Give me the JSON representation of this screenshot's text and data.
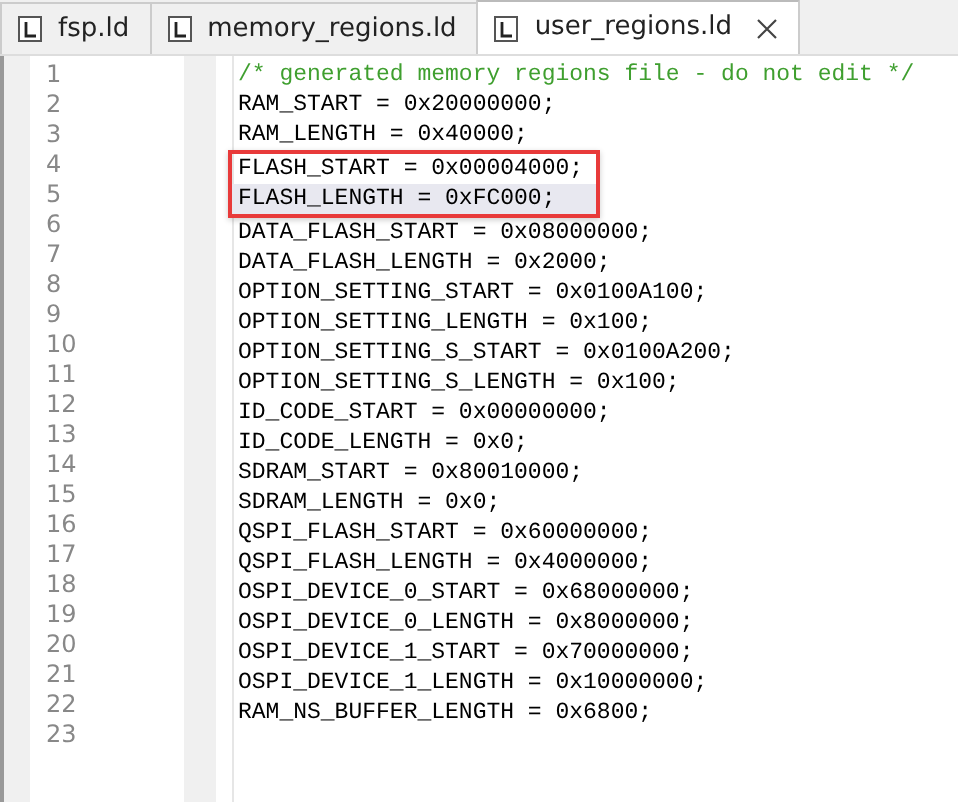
{
  "tabs": [
    {
      "label": "fsp.ld",
      "selected": false
    },
    {
      "label": "memory_regions.ld",
      "selected": false
    },
    {
      "label": "user_regions.ld",
      "selected": true
    }
  ],
  "editor": {
    "lines": [
      {
        "number": "1",
        "text": "/* generated memory regions file - do not edit */",
        "kind": "comment",
        "current": false,
        "highlighted": false
      },
      {
        "number": "2",
        "text": "RAM_START = 0x20000000;",
        "kind": "code",
        "current": false,
        "highlighted": false
      },
      {
        "number": "3",
        "text": "RAM_LENGTH = 0x40000;",
        "kind": "code",
        "current": false,
        "highlighted": false
      },
      {
        "number": "4",
        "text": "FLASH_START = 0x00004000;",
        "kind": "code",
        "current": false,
        "highlighted": true
      },
      {
        "number": "5",
        "text": "FLASH_LENGTH = 0xFC000;",
        "kind": "code",
        "current": true,
        "highlighted": true
      },
      {
        "number": "6",
        "text": "DATA_FLASH_START = 0x08000000;",
        "kind": "code",
        "current": false,
        "highlighted": false
      },
      {
        "number": "7",
        "text": "DATA_FLASH_LENGTH = 0x2000;",
        "kind": "code",
        "current": false,
        "highlighted": false
      },
      {
        "number": "8",
        "text": "OPTION_SETTING_START = 0x0100A100;",
        "kind": "code",
        "current": false,
        "highlighted": false
      },
      {
        "number": "9",
        "text": "OPTION_SETTING_LENGTH = 0x100;",
        "kind": "code",
        "current": false,
        "highlighted": false
      },
      {
        "number": "10",
        "text": "OPTION_SETTING_S_START = 0x0100A200;",
        "kind": "code",
        "current": false,
        "highlighted": false
      },
      {
        "number": "11",
        "text": "OPTION_SETTING_S_LENGTH = 0x100;",
        "kind": "code",
        "current": false,
        "highlighted": false
      },
      {
        "number": "12",
        "text": "ID_CODE_START = 0x00000000;",
        "kind": "code",
        "current": false,
        "highlighted": false
      },
      {
        "number": "13",
        "text": "ID_CODE_LENGTH = 0x0;",
        "kind": "code",
        "current": false,
        "highlighted": false
      },
      {
        "number": "14",
        "text": "SDRAM_START = 0x80010000;",
        "kind": "code",
        "current": false,
        "highlighted": false
      },
      {
        "number": "15",
        "text": "SDRAM_LENGTH = 0x0;",
        "kind": "code",
        "current": false,
        "highlighted": false
      },
      {
        "number": "16",
        "text": "QSPI_FLASH_START = 0x60000000;",
        "kind": "code",
        "current": false,
        "highlighted": false
      },
      {
        "number": "17",
        "text": "QSPI_FLASH_LENGTH = 0x4000000;",
        "kind": "code",
        "current": false,
        "highlighted": false
      },
      {
        "number": "18",
        "text": "OSPI_DEVICE_0_START = 0x68000000;",
        "kind": "code",
        "current": false,
        "highlighted": false
      },
      {
        "number": "19",
        "text": "OSPI_DEVICE_0_LENGTH = 0x8000000;",
        "kind": "code",
        "current": false,
        "highlighted": false
      },
      {
        "number": "20",
        "text": "OSPI_DEVICE_1_START = 0x70000000;",
        "kind": "code",
        "current": false,
        "highlighted": false
      },
      {
        "number": "21",
        "text": "OSPI_DEVICE_1_LENGTH = 0x10000000;",
        "kind": "code",
        "current": false,
        "highlighted": false
      },
      {
        "number": "22",
        "text": "RAM_NS_BUFFER_LENGTH = 0x6800;",
        "kind": "code",
        "current": false,
        "highlighted": false
      },
      {
        "number": "23",
        "kind": "code",
        "current": false,
        "highlighted": false
      }
    ]
  }
}
